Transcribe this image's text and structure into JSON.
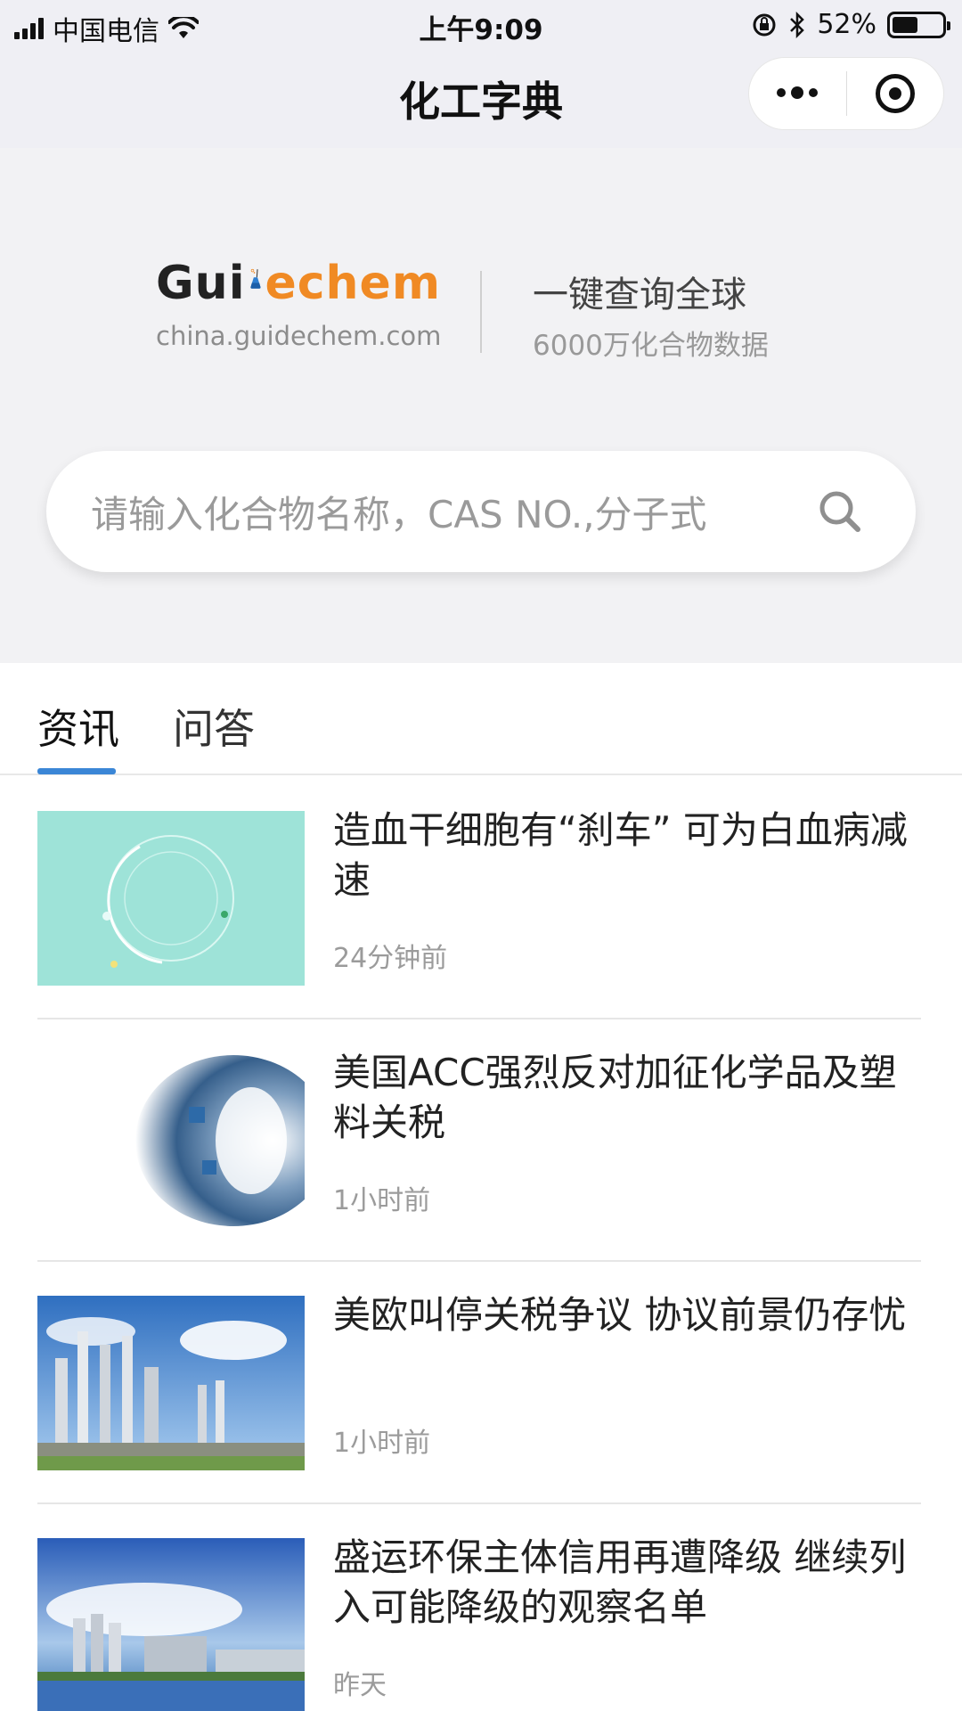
{
  "status": {
    "carrier": "中国电信",
    "time": "上午9:09",
    "battery": "52%",
    "battery_level": 0.52
  },
  "nav": {
    "title": "化工字典",
    "more_icon": "more-dots-icon",
    "close_icon": "target-circle-icon"
  },
  "hero": {
    "logo_text_left": "Gui",
    "logo_text_right": "echem",
    "logo_domain": "china.guidechem.com",
    "slogan": "一键查询全球",
    "slogan_sub": "6000万化合物数据",
    "search_placeholder": "请输入化合物名称，CAS NO.,分子式",
    "accent_color": "#f08a24"
  },
  "tabs": [
    {
      "label": "资讯",
      "active": true
    },
    {
      "label": "问答",
      "active": false
    }
  ],
  "tab_accent": "#3b86d6",
  "news": [
    {
      "title": "造血干细胞有“刹车” 可为白血病减速",
      "time": "24分钟前",
      "thumb": "teal-abstract"
    },
    {
      "title": "美国ACC强烈反对加征化学品及塑料关税",
      "time": "1小时前",
      "thumb": "blue-tech-tunnel"
    },
    {
      "title": "美欧叫停关税争议 协议前景仍存忧",
      "time": "1小时前",
      "thumb": "chemical-plant"
    },
    {
      "title": "盛运环保主体信用再遭降级 继续列入可能降级的观察名单",
      "time": "昨天",
      "thumb": "factory-skyline"
    }
  ]
}
